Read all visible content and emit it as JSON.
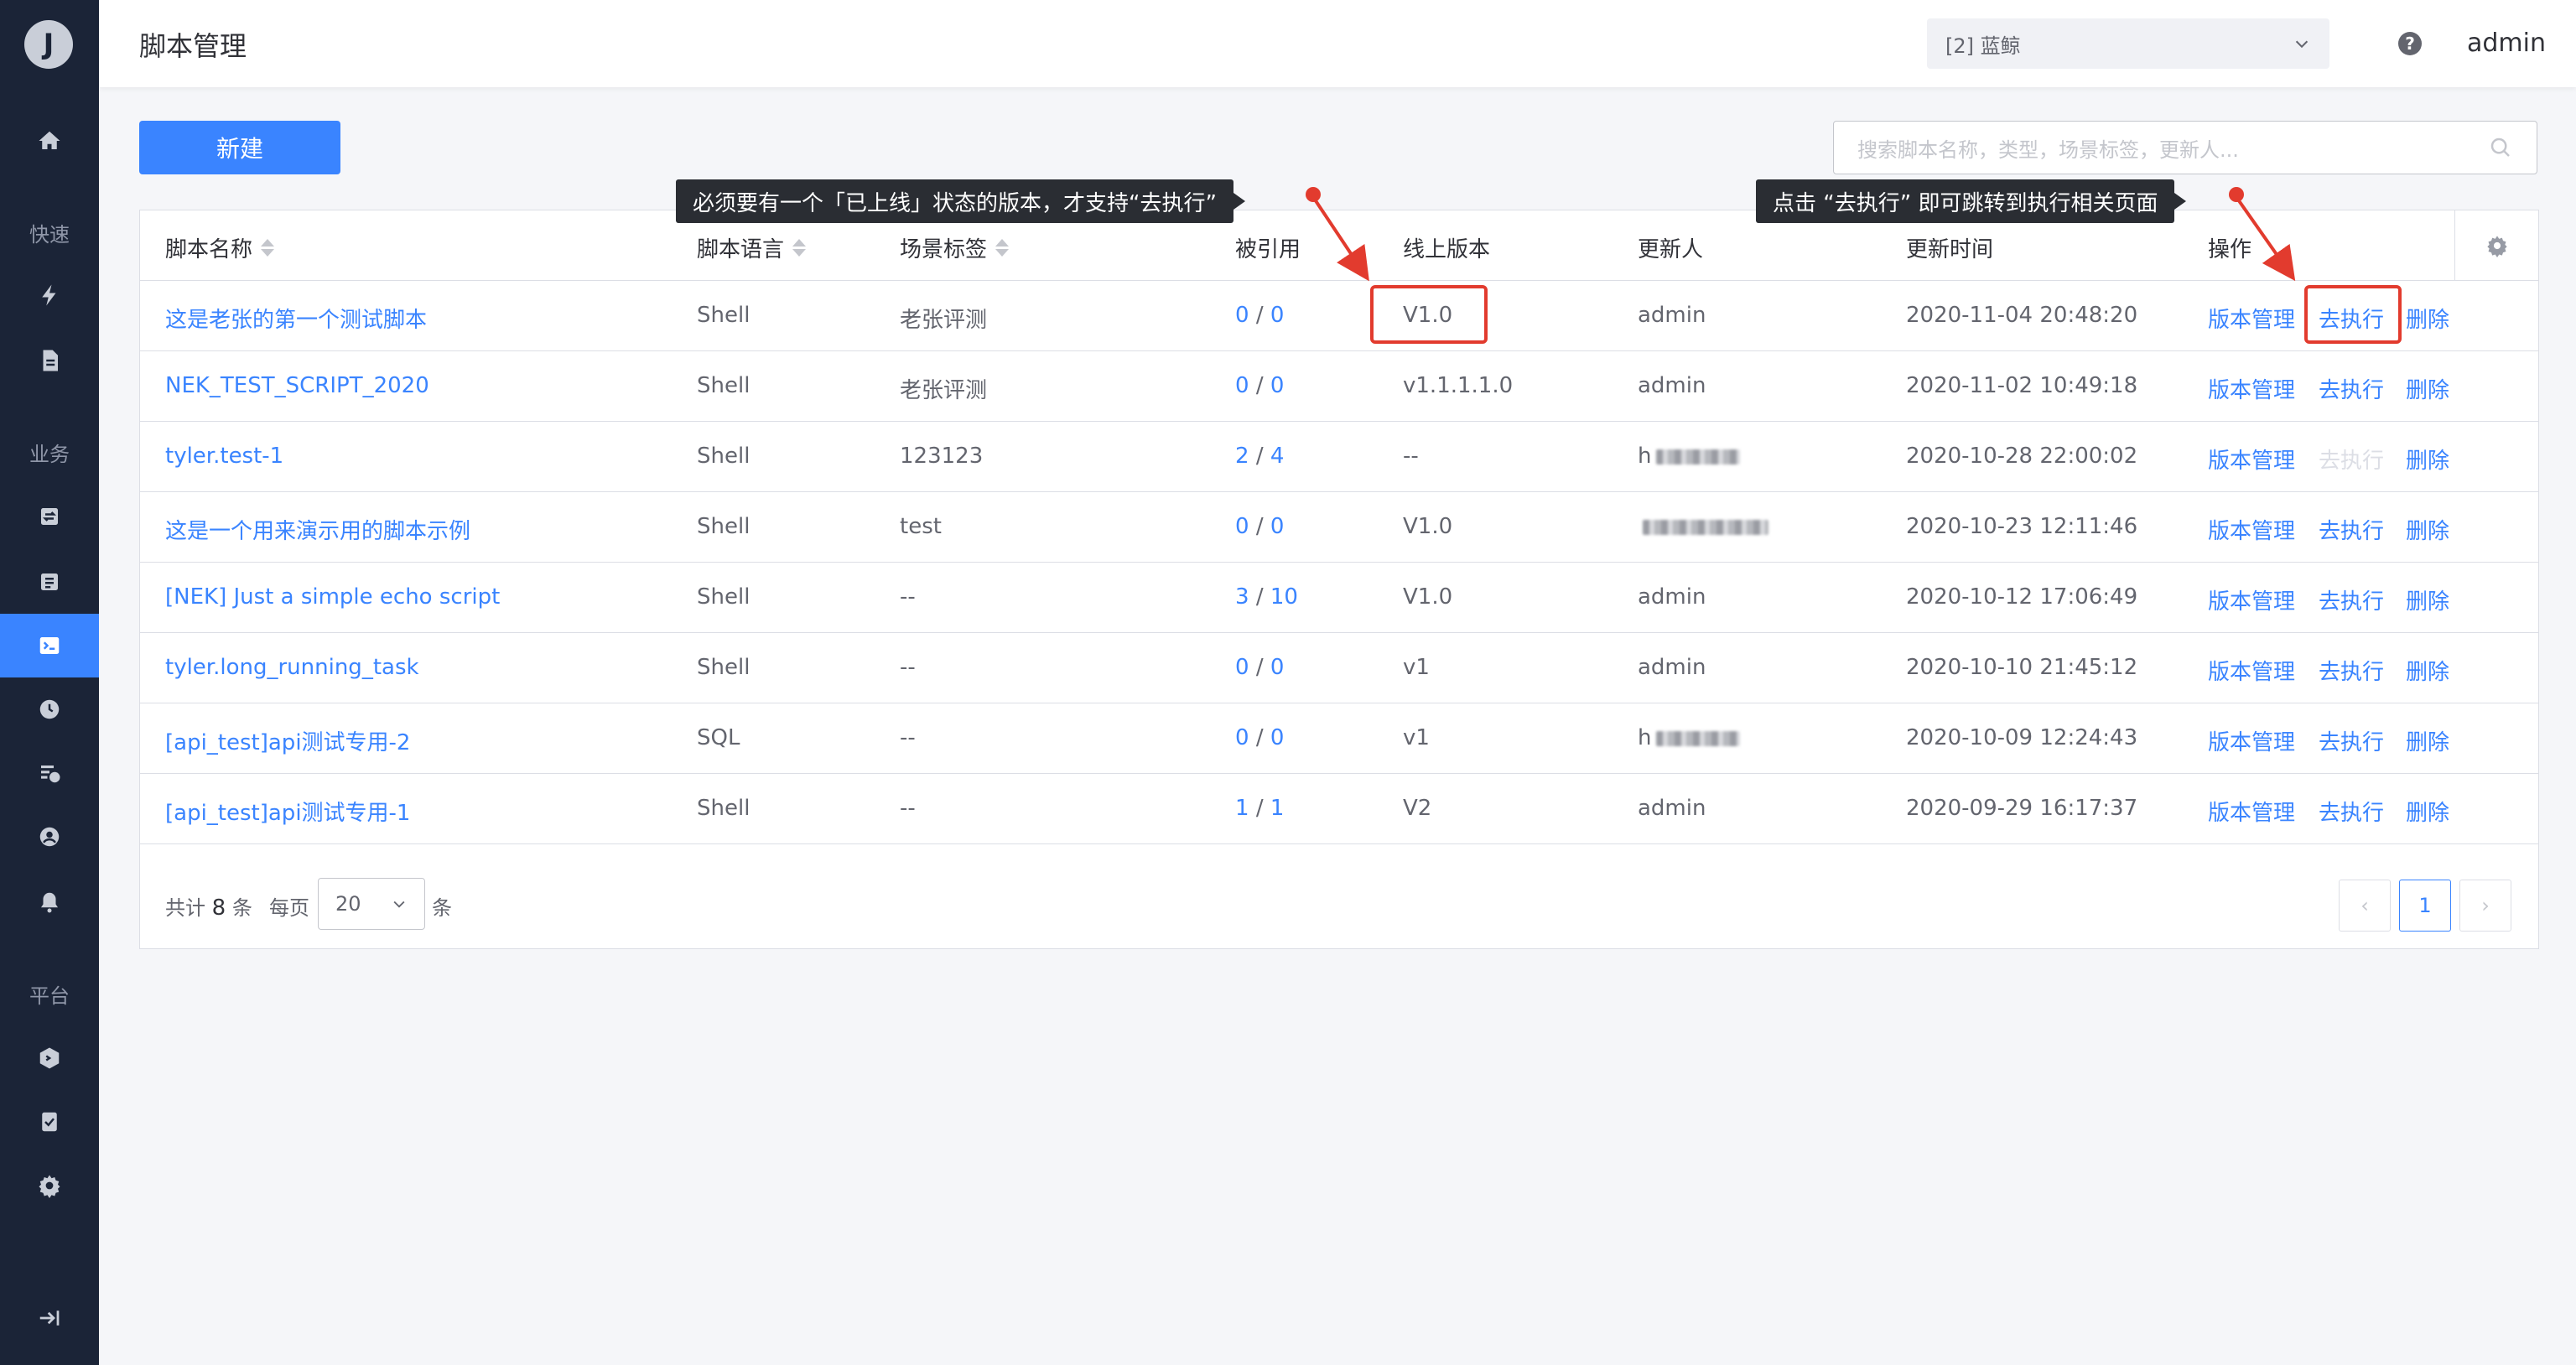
{
  "app": {
    "logo_letter": "J"
  },
  "sidebar": {
    "groups": {
      "quick": "快速",
      "business": "业务",
      "platform": "平台"
    }
  },
  "header": {
    "title": "脚本管理",
    "business_select": "[2] 蓝鲸",
    "help": "?",
    "user": "admin"
  },
  "toolbar": {
    "create_label": "新建",
    "search_placeholder": "搜索脚本名称，类型，场景标签，更新人..."
  },
  "table": {
    "columns": {
      "name": "脚本名称",
      "language": "脚本语言",
      "tag": "场景标签",
      "ref": "被引用",
      "online_version": "线上版本",
      "updater": "更新人",
      "update_time": "更新时间",
      "actions": "操作"
    },
    "action_labels": {
      "versions": "版本管理",
      "execute": "去执行",
      "delete": "删除"
    },
    "rows": [
      {
        "name": "这是老张的第一个测试脚本",
        "language": "Shell",
        "tag": "老张评测",
        "ref_a": "0",
        "ref_sep": "/",
        "ref_b": "0",
        "online_version": "V1.0",
        "updater": "admin",
        "update_time": "2020-11-04 20:48:20",
        "execute_enabled": true
      },
      {
        "name": "NEK_TEST_SCRIPT_2020",
        "language": "Shell",
        "tag": "老张评测",
        "ref_a": "0",
        "ref_sep": "/",
        "ref_b": "0",
        "online_version": "v1.1.1.1.0",
        "updater": "admin",
        "update_time": "2020-11-02 10:49:18",
        "execute_enabled": true
      },
      {
        "name": "tyler.test-1",
        "language": "Shell",
        "tag": "123123",
        "ref_a": "2",
        "ref_sep": "/",
        "ref_b": "4",
        "online_version": "--",
        "updater": "h",
        "update_time": "2020-10-28 22:00:02",
        "execute_enabled": false
      },
      {
        "name": "这是一个用来演示用的脚本示例",
        "language": "Shell",
        "tag": "test",
        "ref_a": "0",
        "ref_sep": "/",
        "ref_b": "0",
        "online_version": "V1.0",
        "updater": "",
        "update_time": "2020-10-23 12:11:46",
        "execute_enabled": true
      },
      {
        "name": "[NEK] Just a simple echo script",
        "language": "Shell",
        "tag": "--",
        "ref_a": "3",
        "ref_sep": "/",
        "ref_b": "10",
        "online_version": "V1.0",
        "updater": "admin",
        "update_time": "2020-10-12 17:06:49",
        "execute_enabled": true
      },
      {
        "name": "tyler.long_running_task",
        "language": "Shell",
        "tag": "--",
        "ref_a": "0",
        "ref_sep": "/",
        "ref_b": "0",
        "online_version": "v1",
        "updater": "admin",
        "update_time": "2020-10-10 21:45:12",
        "execute_enabled": true
      },
      {
        "name": "[api_test]api测试专用-2",
        "language": "SQL",
        "tag": "--",
        "ref_a": "0",
        "ref_sep": "/",
        "ref_b": "0",
        "online_version": "v1",
        "updater": "h",
        "update_time": "2020-10-09 12:24:43",
        "execute_enabled": true
      },
      {
        "name": "[api_test]api测试专用-1",
        "language": "Shell",
        "tag": "--",
        "ref_a": "1",
        "ref_sep": "/",
        "ref_b": "1",
        "online_version": "V2",
        "updater": "admin",
        "update_time": "2020-09-29 16:17:37",
        "execute_enabled": true
      }
    ]
  },
  "pagination": {
    "total_prefix": "共计",
    "total": "8",
    "total_suffix": "条",
    "per_page_label": "每页",
    "per_page": "20",
    "per_page_unit": "条",
    "prev": "‹",
    "current": "1",
    "next": "›"
  },
  "annotations": {
    "tip_version": "必须要有一个「已上线」状态的版本，才支持“去执行”",
    "tip_execute": "点击 “去执行” 即可跳转到执行相关页面",
    "accent_color": "#e23b2e"
  }
}
